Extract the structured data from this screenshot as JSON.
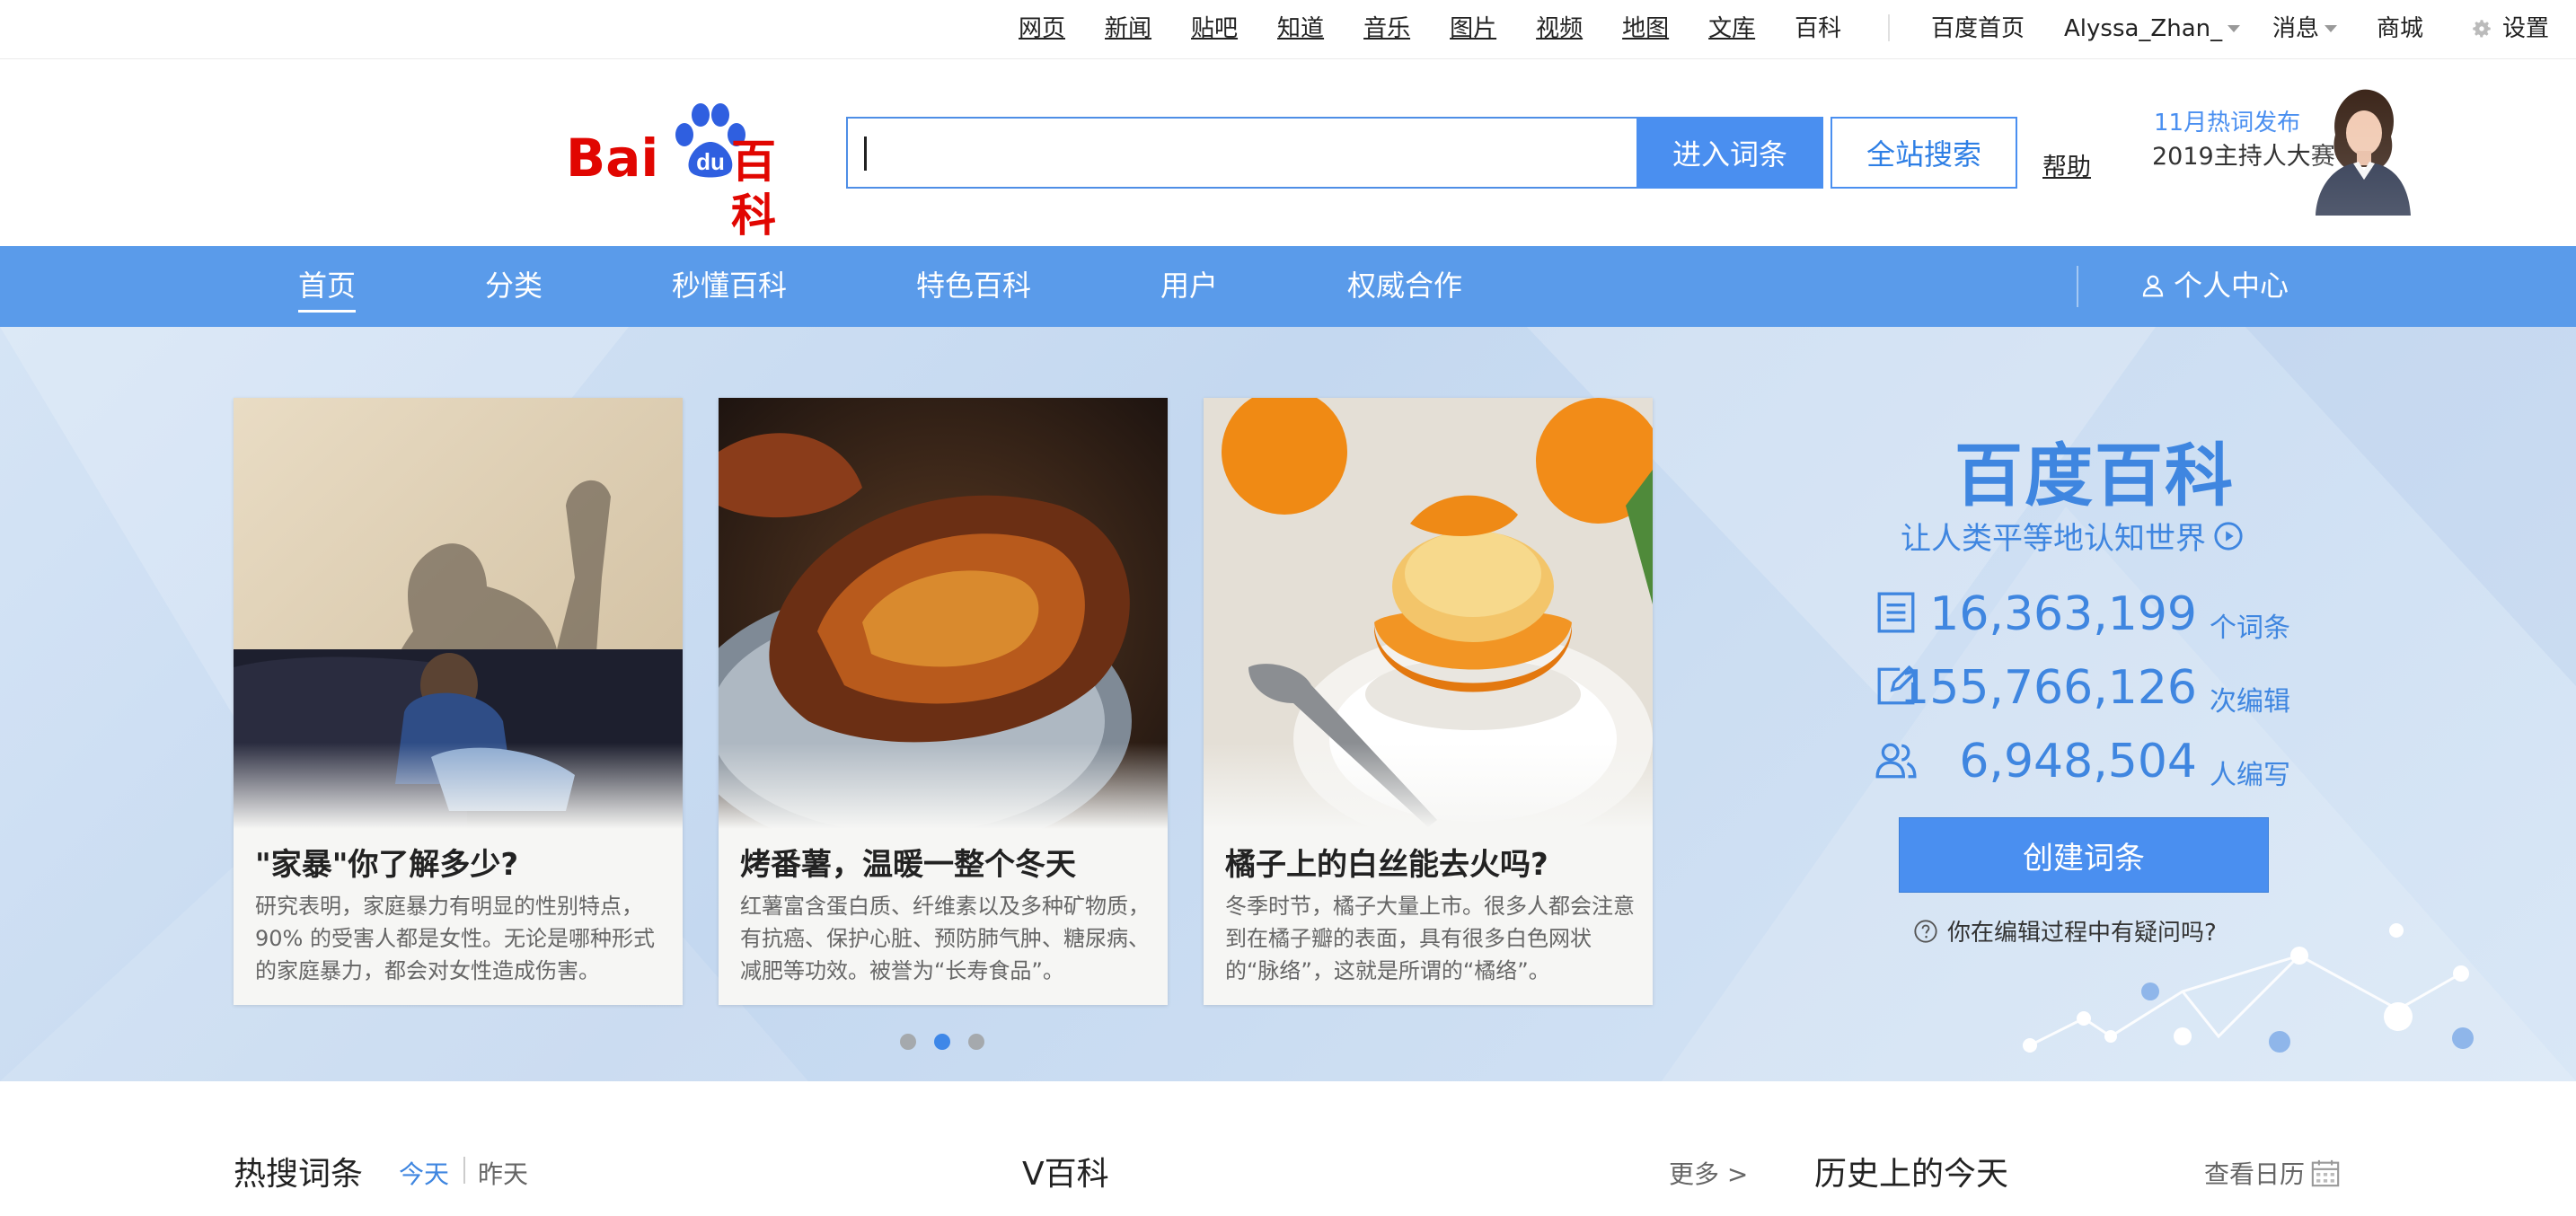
{
  "topbar": {
    "links": [
      "网页",
      "新闻",
      "贴吧",
      "知道",
      "音乐",
      "图片",
      "视频",
      "地图",
      "文库",
      "百科"
    ],
    "baidu_home": "百度首页",
    "username": "Alyssa_Zhan_",
    "messages": "消息",
    "mall": "商城",
    "settings": "设置"
  },
  "header": {
    "logo_bai": "Bai",
    "logo_du": "du",
    "logo_baike": "百科",
    "search_placeholder": "",
    "enter_button": "进入词条",
    "site_search_button": "全站搜索",
    "help": "帮助",
    "promo_line1": "11月热词发布",
    "promo_line2": "2019主持人大赛"
  },
  "nav": {
    "items": [
      "首页",
      "分类",
      "秒懂百科",
      "特色百科",
      "用户",
      "权威合作"
    ],
    "personal": "个人中心"
  },
  "cards": [
    {
      "title": "\"家暴\"你了解多少?",
      "desc": "研究表明，家庭暴力有明显的性别特点，90% 的受害人都是女性。无论是哪种形式的家庭暴力，都会对女性造成伤害。"
    },
    {
      "title": "烤番薯，温暖一整个冬天",
      "desc": "红薯富含蛋白质、纤维素以及多种矿物质，有抗癌、保护心脏、预防肺气肿、糖尿病、减肥等功效。被誉为“长寿食品”。"
    },
    {
      "title": "橘子上的白丝能去火吗?",
      "desc": "冬季时节，橘子大量上市。很多人都会注意到在橘子瓣的表面，具有很多白色网状的“脉络”，这就是所谓的“橘络”。"
    }
  ],
  "carousel": {
    "current": 2,
    "total": 3
  },
  "stats": {
    "title": "百度百科",
    "slogan": "让人类平等地认知世界",
    "entries": "16,363,199",
    "entries_unit": "个词条",
    "edits": "155,766,126",
    "edits_unit": "次编辑",
    "editors": "6,948,504",
    "editors_unit": "人编写",
    "create_button": "创建词条",
    "faq": "你在编辑过程中有疑问吗?"
  },
  "bottom": {
    "hot_title": "热搜词条",
    "today": "今天",
    "yesterday": "昨天",
    "vbaike_title": "V百科",
    "more": "更多 >",
    "history_title": "历史上的今天",
    "calendar": "查看日历"
  },
  "colors": {
    "brand_red": "#e10601",
    "brand_blue": "#4a8ff0",
    "nav_blue": "#5a9bea",
    "stat_blue": "#3f86e0"
  }
}
